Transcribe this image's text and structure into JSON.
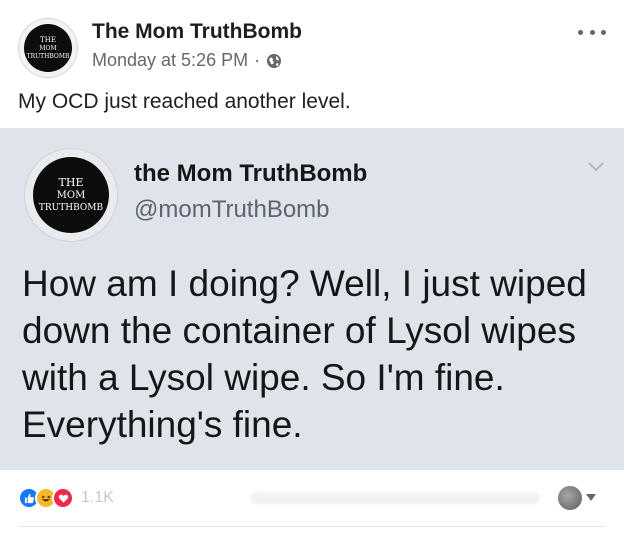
{
  "post": {
    "author": "The Mom TruthBomb",
    "timestamp": "Monday at 5:26 PM",
    "separator": "·",
    "privacy_icon": "globe-icon",
    "more_icon": "more-icon",
    "caption": "My OCD just reached another level.",
    "avatar_logo": {
      "line1": "THE",
      "line2": "MOM",
      "line3": "TRUTHBOMB"
    }
  },
  "tweet": {
    "name": "the Mom TruthBomb",
    "handle": "@momTruthBomb",
    "text": "How am I doing? Well, I just wiped down the container of Lysol wipes with a Lysol wipe. So I'm fine. Everything's fine.",
    "background_color": "#dfe3ea",
    "avatar_logo": {
      "line1": "THE",
      "line2": "MOM",
      "line3": "TRUTHBOMB"
    }
  },
  "reactions": {
    "icons": [
      "like-icon",
      "haha-icon",
      "love-icon"
    ],
    "count": "1.1K",
    "like_color": "#1877f2",
    "haha_color": "#f7b928",
    "love_color": "#f02849"
  }
}
